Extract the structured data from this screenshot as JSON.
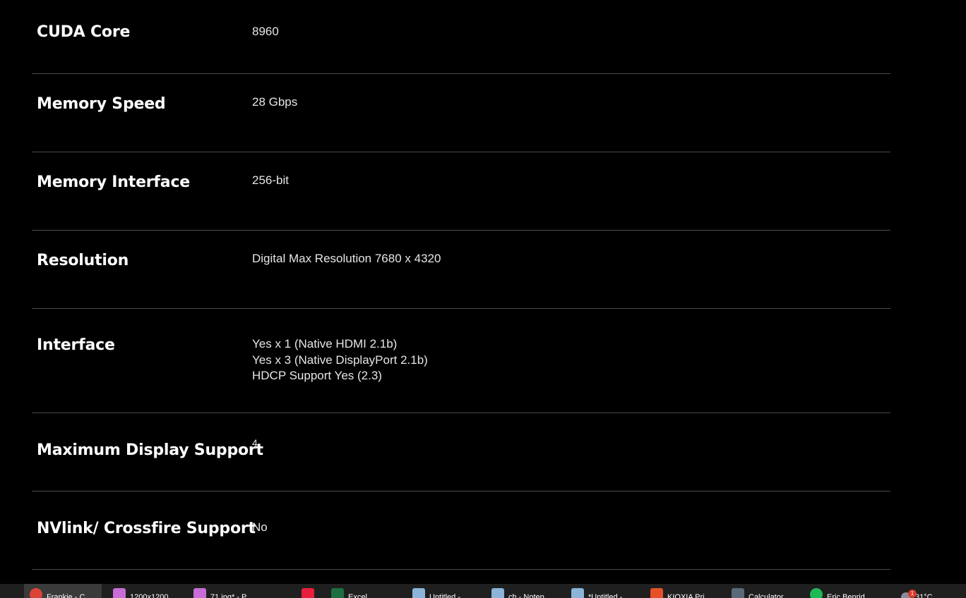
{
  "specs": [
    {
      "label": "CUDA Core",
      "values": [
        "8960"
      ]
    },
    {
      "label": "Memory Speed",
      "values": [
        "28 Gbps"
      ]
    },
    {
      "label": "Memory Interface",
      "values": [
        "256-bit"
      ]
    },
    {
      "label": "Resolution",
      "values": [
        "Digital Max Resolution 7680 x 4320"
      ]
    },
    {
      "label": "Interface",
      "values": [
        "Yes x 1 (Native HDMI 2.1b)",
        "Yes x 3 (Native DisplayPort 2.1b)",
        "HDCP Support Yes (2.3)"
      ]
    },
    {
      "label": "Maximum Display Support",
      "values": [
        "4"
      ]
    },
    {
      "label": "NVlink/ Crossfire Support",
      "values": [
        "No"
      ]
    }
  ],
  "taskbar": {
    "items": [
      {
        "label": "Frankie - C",
        "icon": "chrome-icon",
        "color": "#db4437"
      },
      {
        "label": "1200x1200...",
        "icon": "paint-icon",
        "color": "#c86dd7"
      },
      {
        "label": "71.jpg* - P...",
        "icon": "paint-icon",
        "color": "#c86dd7"
      },
      {
        "label": "",
        "icon": "app-icon",
        "color": "#e81e3c"
      },
      {
        "label": "Excel",
        "icon": "excel-icon",
        "color": "#1d6f42"
      },
      {
        "label": "Untitled -...",
        "icon": "notepad-icon",
        "color": "#8ab4d8"
      },
      {
        "label": "ch - Notep...",
        "icon": "notepad-icon",
        "color": "#8ab4d8"
      },
      {
        "label": "*Untitled -...",
        "icon": "notepad-icon",
        "color": "#8ab4d8"
      },
      {
        "label": "KIOXIA Pri...",
        "icon": "kioxia-icon",
        "color": "#e8502a"
      },
      {
        "label": "Calculator",
        "icon": "calculator-icon",
        "color": "#5a6a7a"
      },
      {
        "label": "Eric Benrid...",
        "icon": "spotify-icon",
        "color": "#1db954"
      }
    ],
    "weather": "31°C",
    "badge_count": "1"
  }
}
